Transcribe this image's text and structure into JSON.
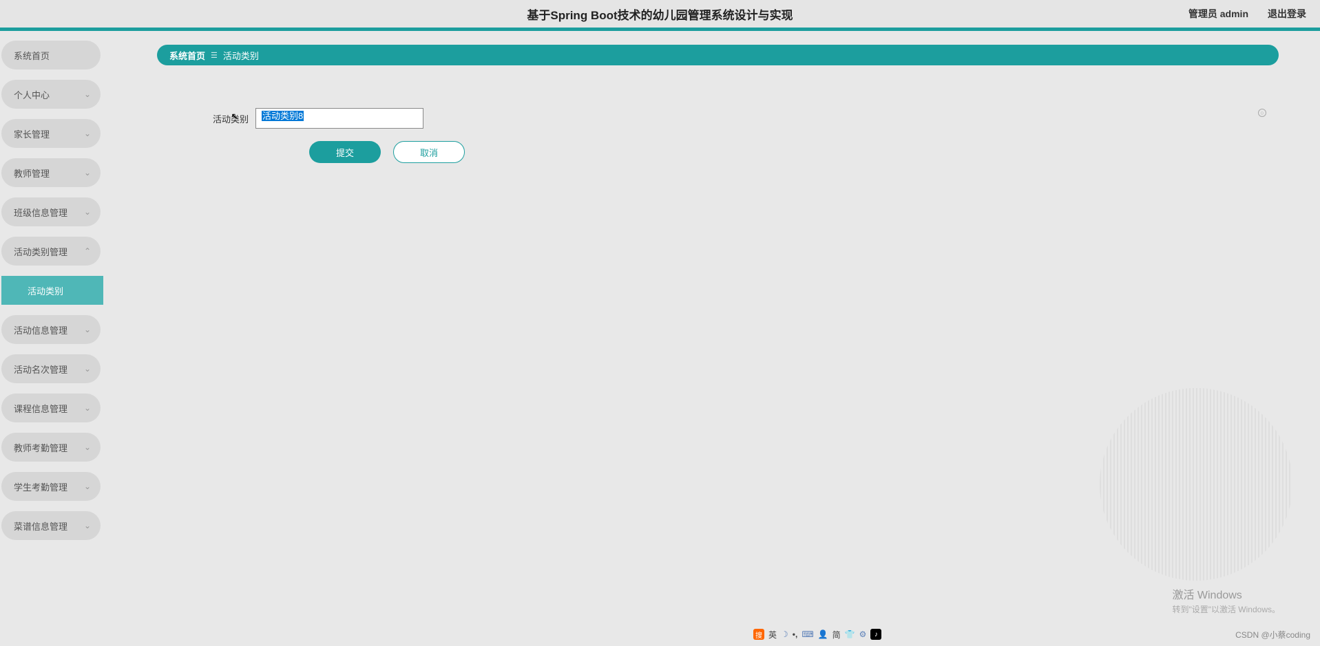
{
  "header": {
    "title": "基于Spring Boot技术的幼儿园管理系统设计与实现",
    "user_label": "管理员 admin",
    "logout": "退出登录"
  },
  "sidebar": {
    "items": [
      {
        "label": "系统首页",
        "expandable": false
      },
      {
        "label": "个人中心",
        "expandable": true
      },
      {
        "label": "家长管理",
        "expandable": true
      },
      {
        "label": "教师管理",
        "expandable": true
      },
      {
        "label": "班级信息管理",
        "expandable": true
      },
      {
        "label": "活动类别管理",
        "expandable": true,
        "expanded": true,
        "children": [
          {
            "label": "活动类别"
          }
        ]
      },
      {
        "label": "活动信息管理",
        "expandable": true
      },
      {
        "label": "活动名次管理",
        "expandable": true
      },
      {
        "label": "课程信息管理",
        "expandable": true
      },
      {
        "label": "教师考勤管理",
        "expandable": true
      },
      {
        "label": "学生考勤管理",
        "expandable": true
      },
      {
        "label": "菜谱信息管理",
        "expandable": true
      }
    ]
  },
  "breadcrumb": {
    "home": "系统首页",
    "sep": "☰",
    "current": "活动类别"
  },
  "form": {
    "field_label": "活动类别",
    "field_value": "活动类别8",
    "submit": "提交",
    "cancel": "取消"
  },
  "watermark": {
    "line1": "激活 Windows",
    "line2": "转到\"设置\"以激活 Windows。"
  },
  "csdn": "CSDN @小蔡coding",
  "ime": {
    "logo": "搜",
    "lang": "英",
    "moon": "☽",
    "comma": "•,",
    "keyboard": "⌨",
    "person": "👤",
    "simple": "简",
    "shirt": "👕",
    "gear": "⚙",
    "tiktok": "♪"
  }
}
